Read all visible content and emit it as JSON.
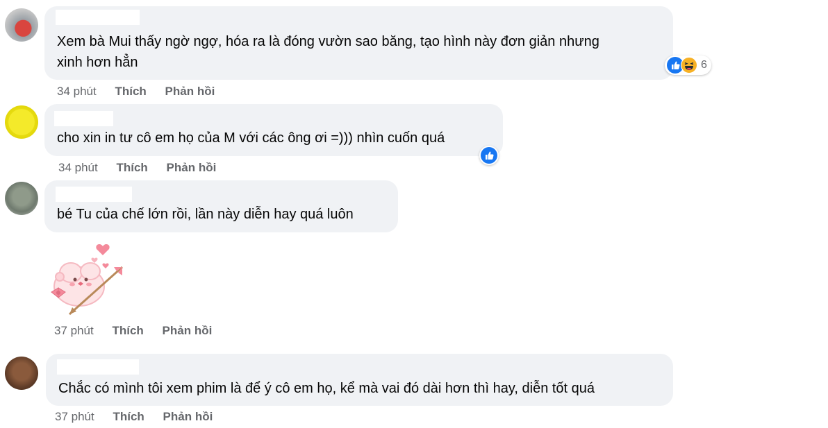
{
  "comments": [
    {
      "text_line1": "Xem bà Mui thấy ngờ ngợ, hóa ra là đóng vườn sao băng, tạo hình này đơn giản nhưng",
      "text_line2": "xinh hơn hẳn",
      "time": "34 phút",
      "like_label": "Thích",
      "reply_label": "Phản hồi",
      "reaction_count": "6",
      "reactions": [
        "like-icon",
        "haha-icon"
      ]
    },
    {
      "text_line1": "cho xin in tư cô em họ của M với các ông ơi =))) nhìn cuốn quá",
      "time": "34 phút",
      "like_label": "Thích",
      "reply_label": "Phản hồi",
      "reactions": [
        "like-icon"
      ]
    },
    {
      "text_line1": "bé Tu của chế lớn rồi, lần này diễn hay quá luôn",
      "sticker": "cupid-bear-sticker",
      "time": "37 phút",
      "like_label": "Thích",
      "reply_label": "Phản hồi"
    },
    {
      "text_line1": "Chắc có mình tôi xem phim là để ý cô em họ, kể mà vai đó dài hơn thì hay, diễn tốt quá",
      "time": "37 phút",
      "like_label": "Thích",
      "reply_label": "Phản hồi"
    }
  ],
  "colors": {
    "bubble": "#f0f2f5",
    "secondary_text": "#65676b",
    "like_blue": "#1877f2",
    "haha_yellow": "#f7b125"
  }
}
